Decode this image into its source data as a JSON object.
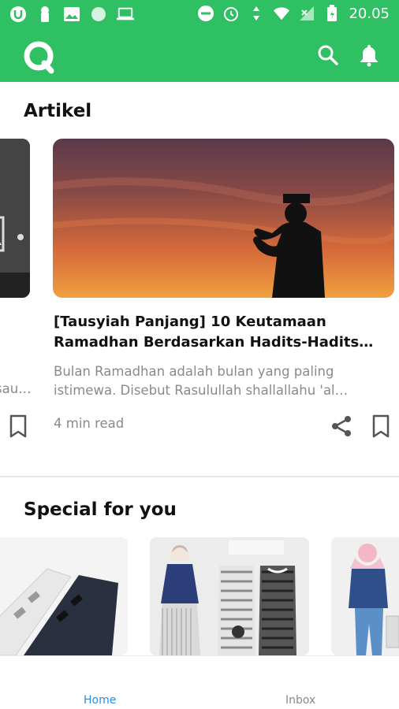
{
  "statusbar": {
    "time": "20.05"
  },
  "header": {
    "logo_icon": "app-logo-q",
    "search_icon": "search-icon",
    "bell_icon": "bell-icon"
  },
  "articles": {
    "section_title": "Artikel",
    "prev_card": {
      "line1": "l",
      "line2": "sau…"
    },
    "card": {
      "title_line1": "[Tausyiah Panjang] 10 Keutamaan",
      "title_line2": "Ramadhan Berdasarkan Hadits-Hadits…",
      "desc_line1": "Bulan Ramadhan adalah bulan yang paling",
      "desc_line2": "istimewa. Disebut Rasulullah shallallahu 'al…",
      "read_time": "4 min read"
    }
  },
  "special": {
    "section_title": "Special for you"
  },
  "bottom_nav": {
    "home_label": "Home",
    "inbox_label": "Inbox"
  },
  "colors": {
    "brand_green": "#2fc063",
    "nav_active": "#2a8de0",
    "muted_text": "#8a8a8a"
  }
}
